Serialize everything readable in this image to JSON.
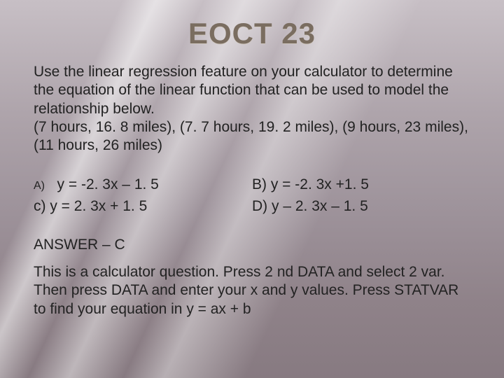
{
  "title": "EOCT 23",
  "prompt": "Use the linear regression feature on your calculator to determine the equation of the linear function that can be used to model the relationship below.\n(7 hours, 16. 8 miles), (7. 7 hours, 19. 2 miles), (9 hours, 23 miles), (11 hours, 26 miles)",
  "choices": {
    "a_label": "A)",
    "a_text": "y = -2. 3x – 1. 5",
    "b_text": "B) y = -2. 3x +1. 5",
    "c_text": "c) y = 2. 3x + 1. 5",
    "d_text": "D) y – 2. 3x – 1. 5"
  },
  "answer": "ANSWER – C",
  "explain": "This is a calculator question.  Press 2 nd DATA and select 2 var. Then press DATA and enter your x and y values. Press  STATVAR to find your equation in y = ax + b"
}
